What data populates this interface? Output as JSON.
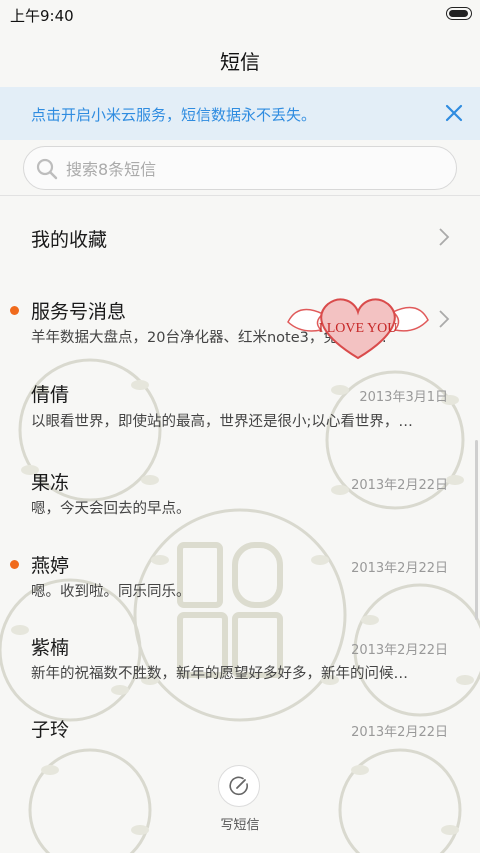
{
  "status_bar": {
    "time": "上午9:40"
  },
  "header": {
    "title": "短信"
  },
  "banner": {
    "text": "点击开启小米云服务，短信数据永不丢失。"
  },
  "search": {
    "placeholder": "搜索8条短信"
  },
  "favorites": {
    "label": "我的收藏"
  },
  "conversations": [
    {
      "name": "服务号消息",
      "preview": "羊年数据大盘点，20台净化器、红米note3，免费领取!",
      "date": "",
      "unread": true
    },
    {
      "name": "倩倩",
      "preview": "以眼看世界，即使站的最高，世界还是很小;以心看世界，…",
      "date": "2013年3月1日",
      "unread": false
    },
    {
      "name": "果冻",
      "preview": "嗯，今天会回去的早点。",
      "date": "2013年2月22日",
      "unread": false
    },
    {
      "name": "燕婷",
      "preview": "嗯。收到啦。同乐同乐。",
      "date": "2013年2月22日",
      "unread": true
    },
    {
      "name": "紫楠",
      "preview": "新年的祝福数不胜数，新年的愿望好多好多，新年的问候…",
      "date": "2013年2月22日",
      "unread": false
    },
    {
      "name": "子玲",
      "preview": "",
      "date": "2013年2月22日",
      "unread": false
    }
  ],
  "sticker": {
    "text": "I LOVE YOU"
  },
  "compose": {
    "label": "写短信"
  },
  "colors": {
    "accent": "#2f8ce0",
    "banner_bg": "#e3eef7",
    "unread": "#f06a1c"
  }
}
